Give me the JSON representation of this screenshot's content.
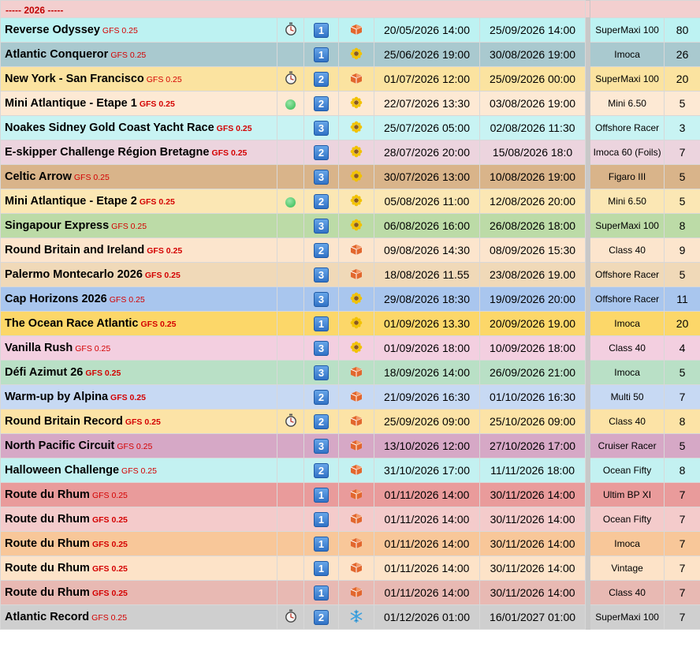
{
  "year_header": "-----  2026  -----",
  "rows": [
    {
      "name": "Reverse Odyssey",
      "gfs": "GFS 0.25",
      "gfs_bold": false,
      "watch": true,
      "dot": false,
      "level": "1",
      "type_icon": "box-icon",
      "start": "20/05/2026 14:00",
      "end": "25/09/2026 14:00",
      "boat_class": "SuperMaxi 100",
      "count": "80",
      "bg": "#bdf2f2"
    },
    {
      "name": "Atlantic Conqueror",
      "gfs": "GFS 0.25",
      "gfs_bold": false,
      "watch": false,
      "dot": false,
      "level": "1",
      "type_icon": "sunflower-icon",
      "start": "25/06/2026 19:00",
      "end": "30/08/2026 19:00",
      "boat_class": "Imoca",
      "count": "26",
      "bg": "#a9c9cf"
    },
    {
      "name": "New York - San Francisco",
      "gfs": "GFS 0.25",
      "gfs_bold": false,
      "watch": true,
      "dot": false,
      "level": "2",
      "type_icon": "box-icon",
      "start": "01/07/2026 12:00",
      "end": "25/09/2026 00:00",
      "boat_class": "SuperMaxi 100",
      "count": "20",
      "bg": "#fbe3a0"
    },
    {
      "name": "Mini Atlantique - Etape 1",
      "gfs": "GFS 0.25",
      "gfs_bold": true,
      "watch": false,
      "dot": true,
      "level": "2",
      "type_icon": "sunflower-icon",
      "start": "22/07/2026 13:30",
      "end": "03/08/2026 19:00",
      "boat_class": "Mini 6.50",
      "count": "5",
      "bg": "#fde9d4"
    },
    {
      "name": "Noakes Sidney Gold Coast Yacht Race",
      "gfs": "GFS 0.25",
      "gfs_bold": true,
      "watch": false,
      "dot": false,
      "level": "3",
      "type_icon": "sunflower-icon",
      "start": "25/07/2026 05:00",
      "end": "02/08/2026 11:30",
      "boat_class": "Offshore Racer",
      "count": "3",
      "bg": "#c8f3f3"
    },
    {
      "name": "E-skipper Challenge Région Bretagne",
      "gfs": "GFS 0.25",
      "gfs_bold": true,
      "watch": false,
      "dot": false,
      "level": "2",
      "type_icon": "sunflower-icon",
      "start": "28/07/2026 20:00",
      "end": "15/08/2026 18:0",
      "boat_class": "Imoca 60 (Foils)",
      "count": "7",
      "bg": "#ecd4de"
    },
    {
      "name": "Celtic Arrow",
      "gfs": "GFS 0.25",
      "gfs_bold": false,
      "watch": false,
      "dot": false,
      "level": "3",
      "type_icon": "sunflower-icon",
      "start": "30/07/2026 13:00",
      "end": "10/08/2026 19:00",
      "boat_class": "Figaro III",
      "count": "5",
      "bg": "#d9b48a"
    },
    {
      "name": "Mini Atlantique - Etape 2",
      "gfs": "GFS 0.25",
      "gfs_bold": true,
      "watch": false,
      "dot": true,
      "level": "2",
      "type_icon": "sunflower-icon",
      "start": "05/08/2026 11:00",
      "end": "12/08/2026 20:00",
      "boat_class": "Mini 6.50",
      "count": "5",
      "bg": "#fbe7b4"
    },
    {
      "name": "Singapour Express",
      "gfs": "GFS 0.25",
      "gfs_bold": false,
      "watch": false,
      "dot": false,
      "level": "3",
      "type_icon": "sunflower-icon",
      "start": "06/08/2026 16:00",
      "end": "26/08/2026 18:00",
      "boat_class": "SuperMaxi 100",
      "count": "8",
      "bg": "#bcdba7"
    },
    {
      "name": "Round Britain and Ireland",
      "gfs": "GFS 0.25",
      "gfs_bold": true,
      "watch": false,
      "dot": false,
      "level": "2",
      "type_icon": "box-icon",
      "start": "09/08/2026 14:30",
      "end": "08/09/2026 15:30",
      "boat_class": "Class 40",
      "count": "9",
      "bg": "#fce5cd"
    },
    {
      "name": "Palermo Montecarlo 2026",
      "gfs": "GFS 0.25",
      "gfs_bold": true,
      "watch": false,
      "dot": false,
      "level": "3",
      "type_icon": "box-icon",
      "start": "18/08/2026 11.55",
      "end": "23/08/2026 19.00",
      "boat_class": "Offshore Racer",
      "count": "5",
      "bg": "#f0d9b8"
    },
    {
      "name": "Cap Horizons 2026",
      "gfs": "GFS 0.25",
      "gfs_bold": false,
      "watch": false,
      "dot": false,
      "level": "3",
      "type_icon": "sunflower-icon",
      "start": "29/08/2026 18:30",
      "end": "19/09/2026 20:00",
      "boat_class": "Offshore Racer",
      "count": "11",
      "bg": "#a9c6ee"
    },
    {
      "name": "The Ocean Race Atlantic",
      "gfs": "GFS 0.25",
      "gfs_bold": true,
      "watch": false,
      "dot": false,
      "level": "1",
      "type_icon": "sunflower-icon",
      "start": "01/09/2026 13.30",
      "end": "20/09/2026 19.00",
      "boat_class": "Imoca",
      "count": "20",
      "bg": "#fcd769"
    },
    {
      "name": "Vanilla Rush",
      "gfs": "GFS 0.25",
      "gfs_bold": false,
      "watch": false,
      "dot": false,
      "level": "3",
      "type_icon": "sunflower-icon",
      "start": "01/09/2026 18:00",
      "end": "10/09/2026 18:00",
      "boat_class": "Class 40",
      "count": "4",
      "bg": "#f3cfe0"
    },
    {
      "name": "Défi Azimut 26",
      "gfs": "GFS 0.25",
      "gfs_bold": true,
      "watch": false,
      "dot": false,
      "level": "3",
      "type_icon": "box-icon",
      "start": "18/09/2026 14:00",
      "end": "26/09/2026 21:00",
      "boat_class": "Imoca",
      "count": "5",
      "bg": "#b9e0c6"
    },
    {
      "name": "Warm-up by Alpina",
      "gfs": "GFS 0.25",
      "gfs_bold": true,
      "watch": false,
      "dot": false,
      "level": "2",
      "type_icon": "box-icon",
      "start": "21/09/2026 16:30",
      "end": "01/10/2026 16:30",
      "boat_class": "Multi 50",
      "count": "7",
      "bg": "#c7d9f3"
    },
    {
      "name": "Round Britain Record",
      "gfs": "GFS 0.25",
      "gfs_bold": true,
      "watch": true,
      "dot": false,
      "level": "2",
      "type_icon": "box-icon",
      "start": "25/09/2026 09:00",
      "end": "25/10/2026 09:00",
      "boat_class": "Class 40",
      "count": "8",
      "bg": "#fce3a6"
    },
    {
      "name": "North Pacific Circuit",
      "gfs": "GFS 0.25",
      "gfs_bold": false,
      "watch": false,
      "dot": false,
      "level": "3",
      "type_icon": "box-icon",
      "start": "13/10/2026 12:00",
      "end": "27/10/2026 17:00",
      "boat_class": "Cruiser Racer",
      "count": "5",
      "bg": "#d6a8c6"
    },
    {
      "name": "Halloween Challenge",
      "gfs": "GFS 0.25",
      "gfs_bold": false,
      "watch": false,
      "dot": false,
      "level": "2",
      "type_icon": "box-icon",
      "start": "31/10/2026 17:00",
      "end": "11/11/2026 18:00",
      "boat_class": "Ocean Fifty",
      "count": "8",
      "bg": "#c3f1f1"
    },
    {
      "name": "Route du Rhum",
      "gfs": "GFS 0.25",
      "gfs_bold": false,
      "watch": false,
      "dot": false,
      "level": "1",
      "type_icon": "box-icon",
      "start": "01/11/2026 14:00",
      "end": "30/11/2026 14:00",
      "boat_class": "Ultim BP XI",
      "count": "7",
      "bg": "#e99b9b"
    },
    {
      "name": "Route du Rhum",
      "gfs": "GFS 0.25",
      "gfs_bold": true,
      "watch": false,
      "dot": false,
      "level": "1",
      "type_icon": "box-icon",
      "start": "01/11/2026 14:00",
      "end": "30/11/2026 14:00",
      "boat_class": "Ocean Fifty",
      "count": "7",
      "bg": "#f4cbcb"
    },
    {
      "name": "Route du Rhum",
      "gfs": "GFS 0.25",
      "gfs_bold": true,
      "watch": false,
      "dot": false,
      "level": "1",
      "type_icon": "box-icon",
      "start": "01/11/2026 14:00",
      "end": "30/11/2026 14:00",
      "boat_class": "Imoca",
      "count": "7",
      "bg": "#f8c799"
    },
    {
      "name": "Route du Rhum",
      "gfs": "GFS 0.25",
      "gfs_bold": true,
      "watch": false,
      "dot": false,
      "level": "1",
      "type_icon": "box-icon",
      "start": "01/11/2026 14:00",
      "end": "30/11/2026 14:00",
      "boat_class": "Vintage",
      "count": "7",
      "bg": "#fde3c8"
    },
    {
      "name": "Route du Rhum",
      "gfs": "GFS 0.25",
      "gfs_bold": true,
      "watch": false,
      "dot": false,
      "level": "1",
      "type_icon": "box-icon",
      "start": "01/11/2026 14:00",
      "end": "30/11/2026 14:00",
      "boat_class": "Class 40",
      "count": "7",
      "bg": "#e8b9b3"
    },
    {
      "name": "Atlantic Record",
      "gfs": "GFS 0.25",
      "gfs_bold": false,
      "watch": true,
      "dot": false,
      "level": "2",
      "type_icon": "snowflake-icon",
      "start": "01/12/2026 01:00",
      "end": "16/01/2027 01:00",
      "boat_class": "SuperMaxi 100",
      "count": "7",
      "bg": "#cfcfcf"
    }
  ]
}
